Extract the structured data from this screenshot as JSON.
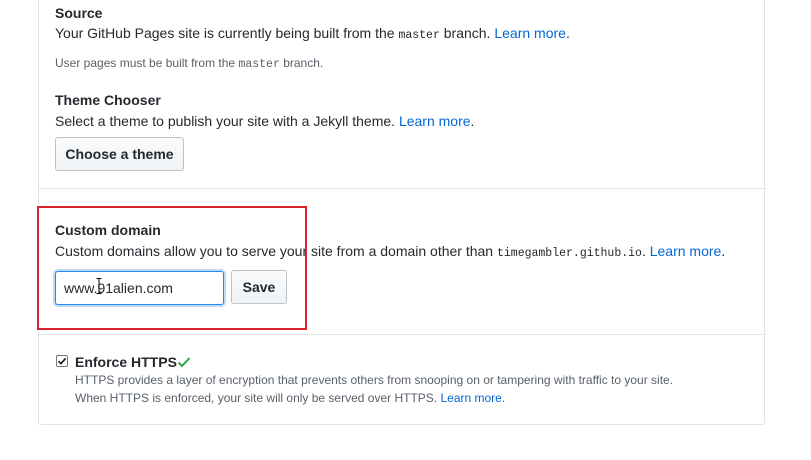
{
  "source": {
    "title": "Source",
    "desc_before": "Your GitHub Pages site is currently being built from the",
    "branch": "master",
    "desc_after": "branch.",
    "learn_more": "Learn more",
    "period": ".",
    "note_before": "User pages must be built from the",
    "note_branch": "master",
    "note_after": "branch."
  },
  "theme": {
    "title": "Theme Chooser",
    "desc": "Select a theme to publish your site with a Jekyll theme.",
    "learn_more": "Learn more",
    "period": ".",
    "button_label": "Choose a theme"
  },
  "custom_domain": {
    "title": "Custom domain",
    "desc_before": "Custom domains allow you to serve your site from a domain other than",
    "domain": "timegambler.github.io",
    "period1": ".",
    "learn_more": "Learn more",
    "period2": ".",
    "input_value": "www.91alien.com",
    "save_label": "Save"
  },
  "https": {
    "title": "Enforce HTTPS",
    "checked": true,
    "line1": "HTTPS provides a layer of encryption that prevents others from snooping on or tampering with traffic to your site.",
    "line2_before": "When HTTPS is enforced, your site will only be served over HTTPS.",
    "learn_more": "Learn more",
    "period": "."
  },
  "colors": {
    "link": "#0366d6",
    "highlight_box": "#d9242b",
    "check_green": "#28a745"
  },
  "icons": {
    "check": "check-icon",
    "checkbox_mark": "checkbox-mark-icon",
    "text_cursor": "text-cursor-icon"
  }
}
